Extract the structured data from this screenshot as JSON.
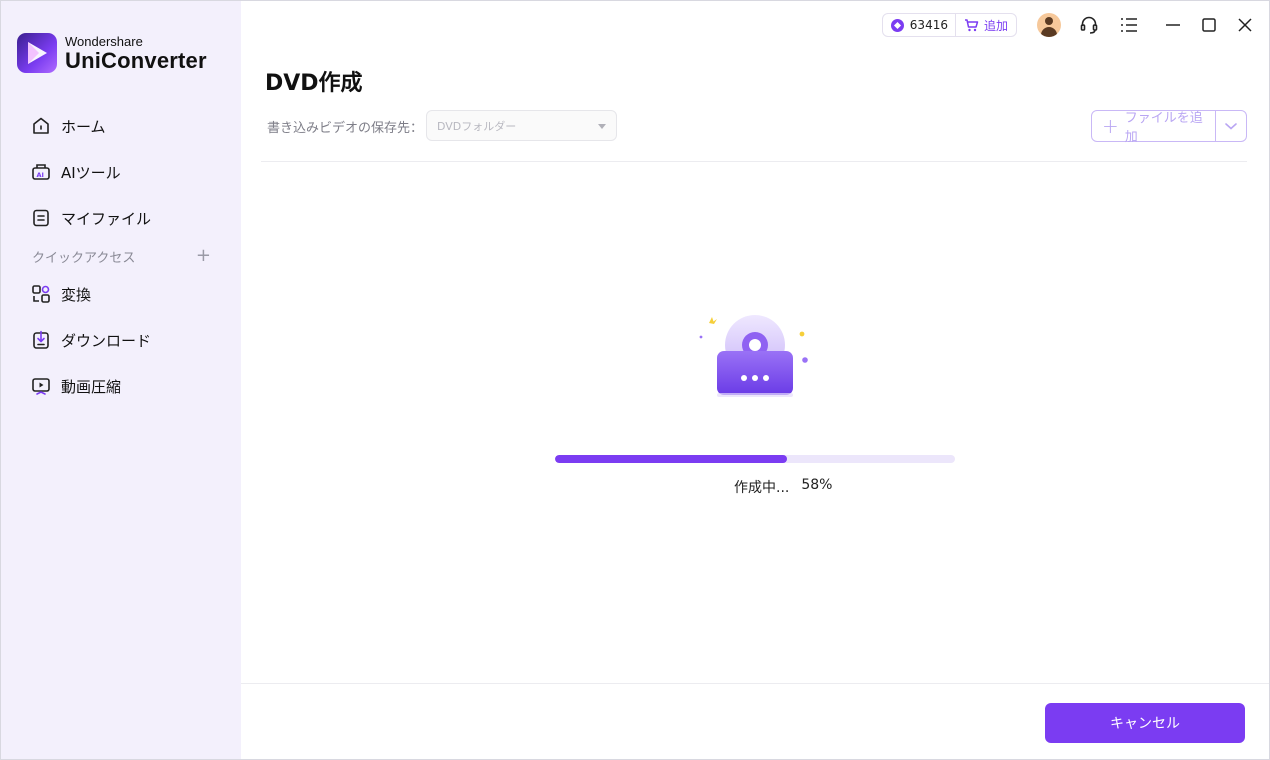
{
  "app": {
    "brand_small": "Wondershare",
    "brand_big": "UniConverter",
    "accent_color": "#7b3cf2"
  },
  "topbar": {
    "coin_count": "63416",
    "add_label": "追加",
    "icons": [
      "gem-icon",
      "cart-icon",
      "avatar",
      "headset-icon",
      "menu-list-icon",
      "minimize-icon",
      "maximize-icon",
      "close-icon"
    ]
  },
  "sidebar": {
    "items": [
      {
        "label": "ホーム",
        "icon": "home-icon"
      },
      {
        "label": "AIツール",
        "icon": "ai-tools-icon"
      },
      {
        "label": "マイファイル",
        "icon": "my-files-icon"
      }
    ],
    "quick_access_label": "クイックアクセス",
    "quick_items": [
      {
        "label": "変換",
        "icon": "convert-icon"
      },
      {
        "label": "ダウンロード",
        "icon": "download-icon"
      },
      {
        "label": "動画圧縮",
        "icon": "compress-icon"
      }
    ]
  },
  "main": {
    "title": "DVD作成",
    "save_label": "書き込みビデオの保存先：",
    "save_select_value": "DVDフォルダー",
    "add_file_label": "ファイルを追加",
    "progress_percent": 58,
    "status_text": "作成中...",
    "status_percent": "58%",
    "cancel_label": "キャンセル"
  }
}
